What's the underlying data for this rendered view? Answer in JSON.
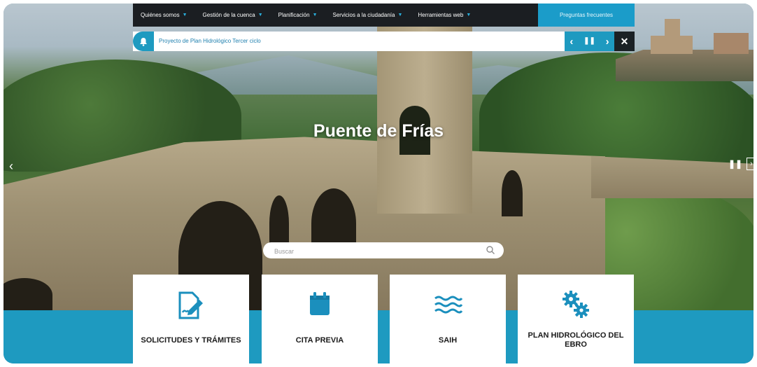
{
  "nav": {
    "items": [
      {
        "label": "Quiénes somos"
      },
      {
        "label": "Gestión de la cuenca"
      },
      {
        "label": "Planificación"
      },
      {
        "label": "Servicios a la ciudadanía"
      },
      {
        "label": "Herramientas web"
      }
    ],
    "faq_label": "Preguntas frecuentes"
  },
  "notice": {
    "text": "Proyecto de Plan Hidrológico Tercer ciclo",
    "icon": "bell-icon"
  },
  "hero": {
    "title": "Puente de Frías"
  },
  "search": {
    "placeholder": "Buscar",
    "value": ""
  },
  "cards": [
    {
      "label": "SOLICITUDES Y TRÁMITES",
      "icon": "document-edit-icon"
    },
    {
      "label": "CITA PREVIA",
      "icon": "calendar-icon"
    },
    {
      "label": "SAIH",
      "icon": "waves-icon"
    },
    {
      "label": "PLAN HIDROLÓGICO DEL EBRO",
      "icon": "gears-icon"
    }
  ],
  "colors": {
    "accent": "#1e9ac0",
    "nav_bg": "#1b1e22",
    "icon_blue": "#1b8fbd"
  }
}
